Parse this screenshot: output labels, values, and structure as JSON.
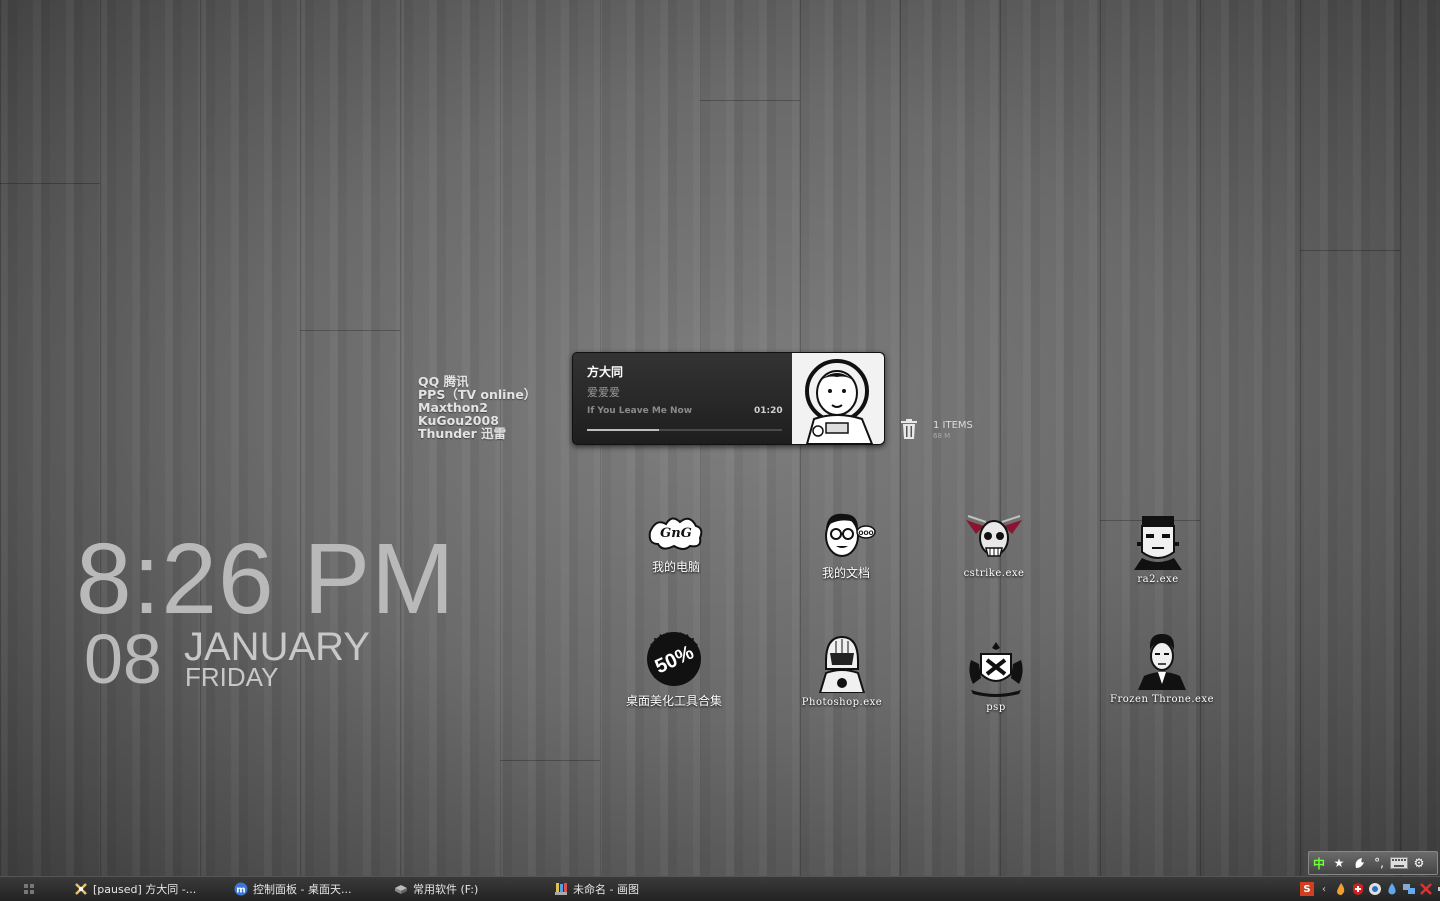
{
  "app_list": [
    "QQ 腾讯",
    "PPS（TV online）",
    "Maxthon2",
    "KuGou2008",
    "Thunder 迅雷"
  ],
  "clock": {
    "time": "8:26 PM",
    "day": "08",
    "month": "JANUARY",
    "weekday": "FRIDAY"
  },
  "player": {
    "artist": "方大同",
    "album": "爱爱爱",
    "track": "If You Leave Me Now",
    "time": "01:20",
    "progress": 0.37
  },
  "recycle": {
    "count": "1 ITEMS",
    "size": "68 M"
  },
  "icons": [
    {
      "label": "我的电脑",
      "icon": "graffiti-icon"
    },
    {
      "label": "我的文档",
      "icon": "nerd-face-icon"
    },
    {
      "label": "cstrike.exe",
      "icon": "winged-skull-icon"
    },
    {
      "label": "ra2.exe",
      "icon": "frankenstein-icon"
    },
    {
      "label": "桌面美化工具合集",
      "icon": "sale-50-icon"
    },
    {
      "label": "Photoshop.exe",
      "icon": "daft-punk-icon"
    },
    {
      "label": "psp",
      "icon": "crest-icon"
    },
    {
      "label": "Frozen Throne.exe",
      "icon": "man-portrait-icon"
    }
  ],
  "taskbar": {
    "items": [
      {
        "label": "[paused] 方大同 -...",
        "icon": "music-icon"
      },
      {
        "label": "控制面板 - 桌面天...",
        "icon": "maxthon-icon"
      },
      {
        "label": "常用软件 (F:)",
        "icon": "drive-icon"
      },
      {
        "label": "未命名 - 画图",
        "icon": "paint-icon"
      }
    ]
  },
  "ime": {
    "mode": "中"
  },
  "colors": {
    "clock": "#b9b9b9",
    "player_bg": "#262626",
    "taskbar": "#2a2a2a"
  }
}
